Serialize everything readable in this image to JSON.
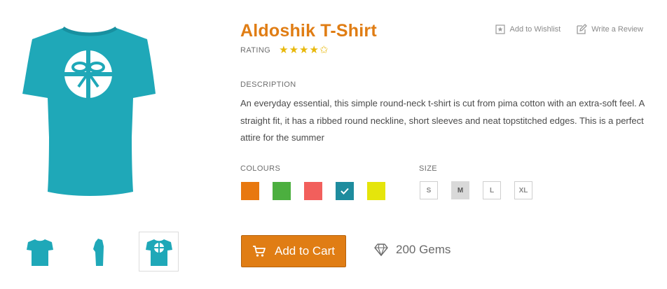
{
  "product": {
    "title": "Aldoshik T-Shirt",
    "rating_label": "RATING",
    "rating_stars": "★★★★✩",
    "description_label": "DESCRIPTION",
    "description": "An everyday essential, this simple round-neck t-shirt is cut from pima cotton with an extra-soft feel. A straight fit, it has a ribbed round neckline, short sleeves and neat topstitched edges. This is a perfect attire for the summer"
  },
  "actions": {
    "wishlist_label": "Add to Wishlist",
    "review_label": "Write a Review"
  },
  "colours": {
    "label": "COLOURS",
    "swatches": [
      "#e8780f",
      "#4caf3f",
      "#f25f5c",
      "#1e8c9e",
      "#e5e50b"
    ],
    "selected_index": 3
  },
  "sizes": {
    "label": "SIZE",
    "options": [
      "S",
      "M",
      "L",
      "XL"
    ],
    "selected": "M"
  },
  "cart": {
    "button_label": "Add to Cart",
    "gems_label": "200 Gems"
  },
  "icons": {
    "cart": "cart-icon",
    "gem": "diamond-icon",
    "wishlist": "star-box-icon",
    "review": "pencil-icon"
  },
  "colors": {
    "accent": "#e07d14",
    "star": "#e8b80a",
    "shirt": "#1fa8b8"
  }
}
